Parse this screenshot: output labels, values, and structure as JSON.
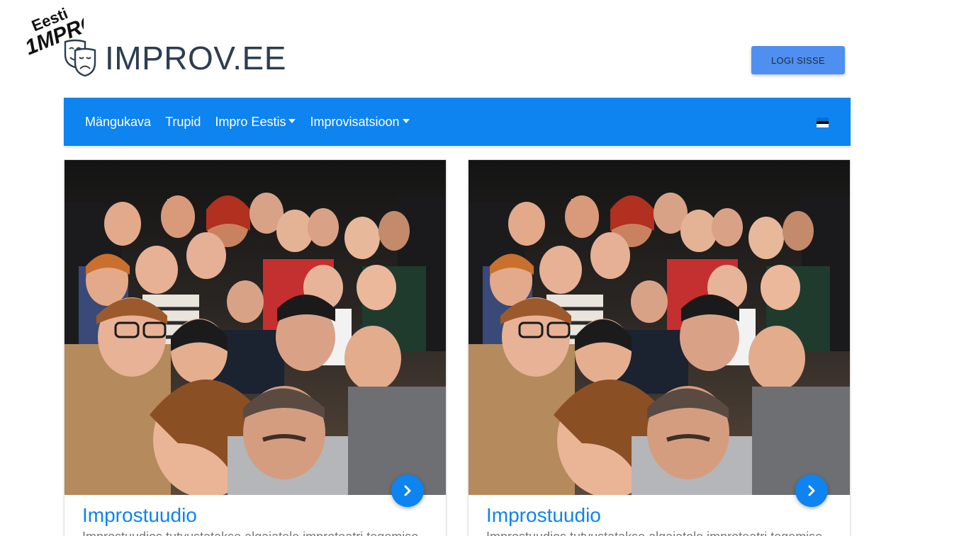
{
  "corner_logo": {
    "icon": "eesti-impro-logo",
    "text_top": "Eesti",
    "text_bottom": "IMPRO"
  },
  "brand": {
    "icon": "theater-masks-icon",
    "title": "IMPROV.EE"
  },
  "header": {
    "login_label": "LOGI SISSE"
  },
  "nav": {
    "items": [
      {
        "label": "Mängukava",
        "dropdown": false
      },
      {
        "label": "Trupid",
        "dropdown": false
      },
      {
        "label": "Impro Eestis",
        "dropdown": true
      },
      {
        "label": "Improvisatsioon",
        "dropdown": true
      }
    ],
    "language_flag": {
      "icon": "estonian-flag-icon",
      "colors": [
        "#0072ce",
        "#000000",
        "#ffffff"
      ]
    }
  },
  "cards": [
    {
      "image": "group-selfie-photo",
      "title": "Improstuudio",
      "description": "Improstuudios tutvustatakse algajatele improteatri tegemise",
      "action_icon": "chevron-right-icon"
    },
    {
      "image": "group-selfie-photo",
      "title": "Improstuudio",
      "description": "Improstuudios tutvustatakse algajatele improteatri tegemise",
      "action_icon": "chevron-right-icon"
    }
  ],
  "colors": {
    "accent": "#0d84f0",
    "login_button": "#4f8ff0",
    "brand_text": "#2c3e50"
  }
}
